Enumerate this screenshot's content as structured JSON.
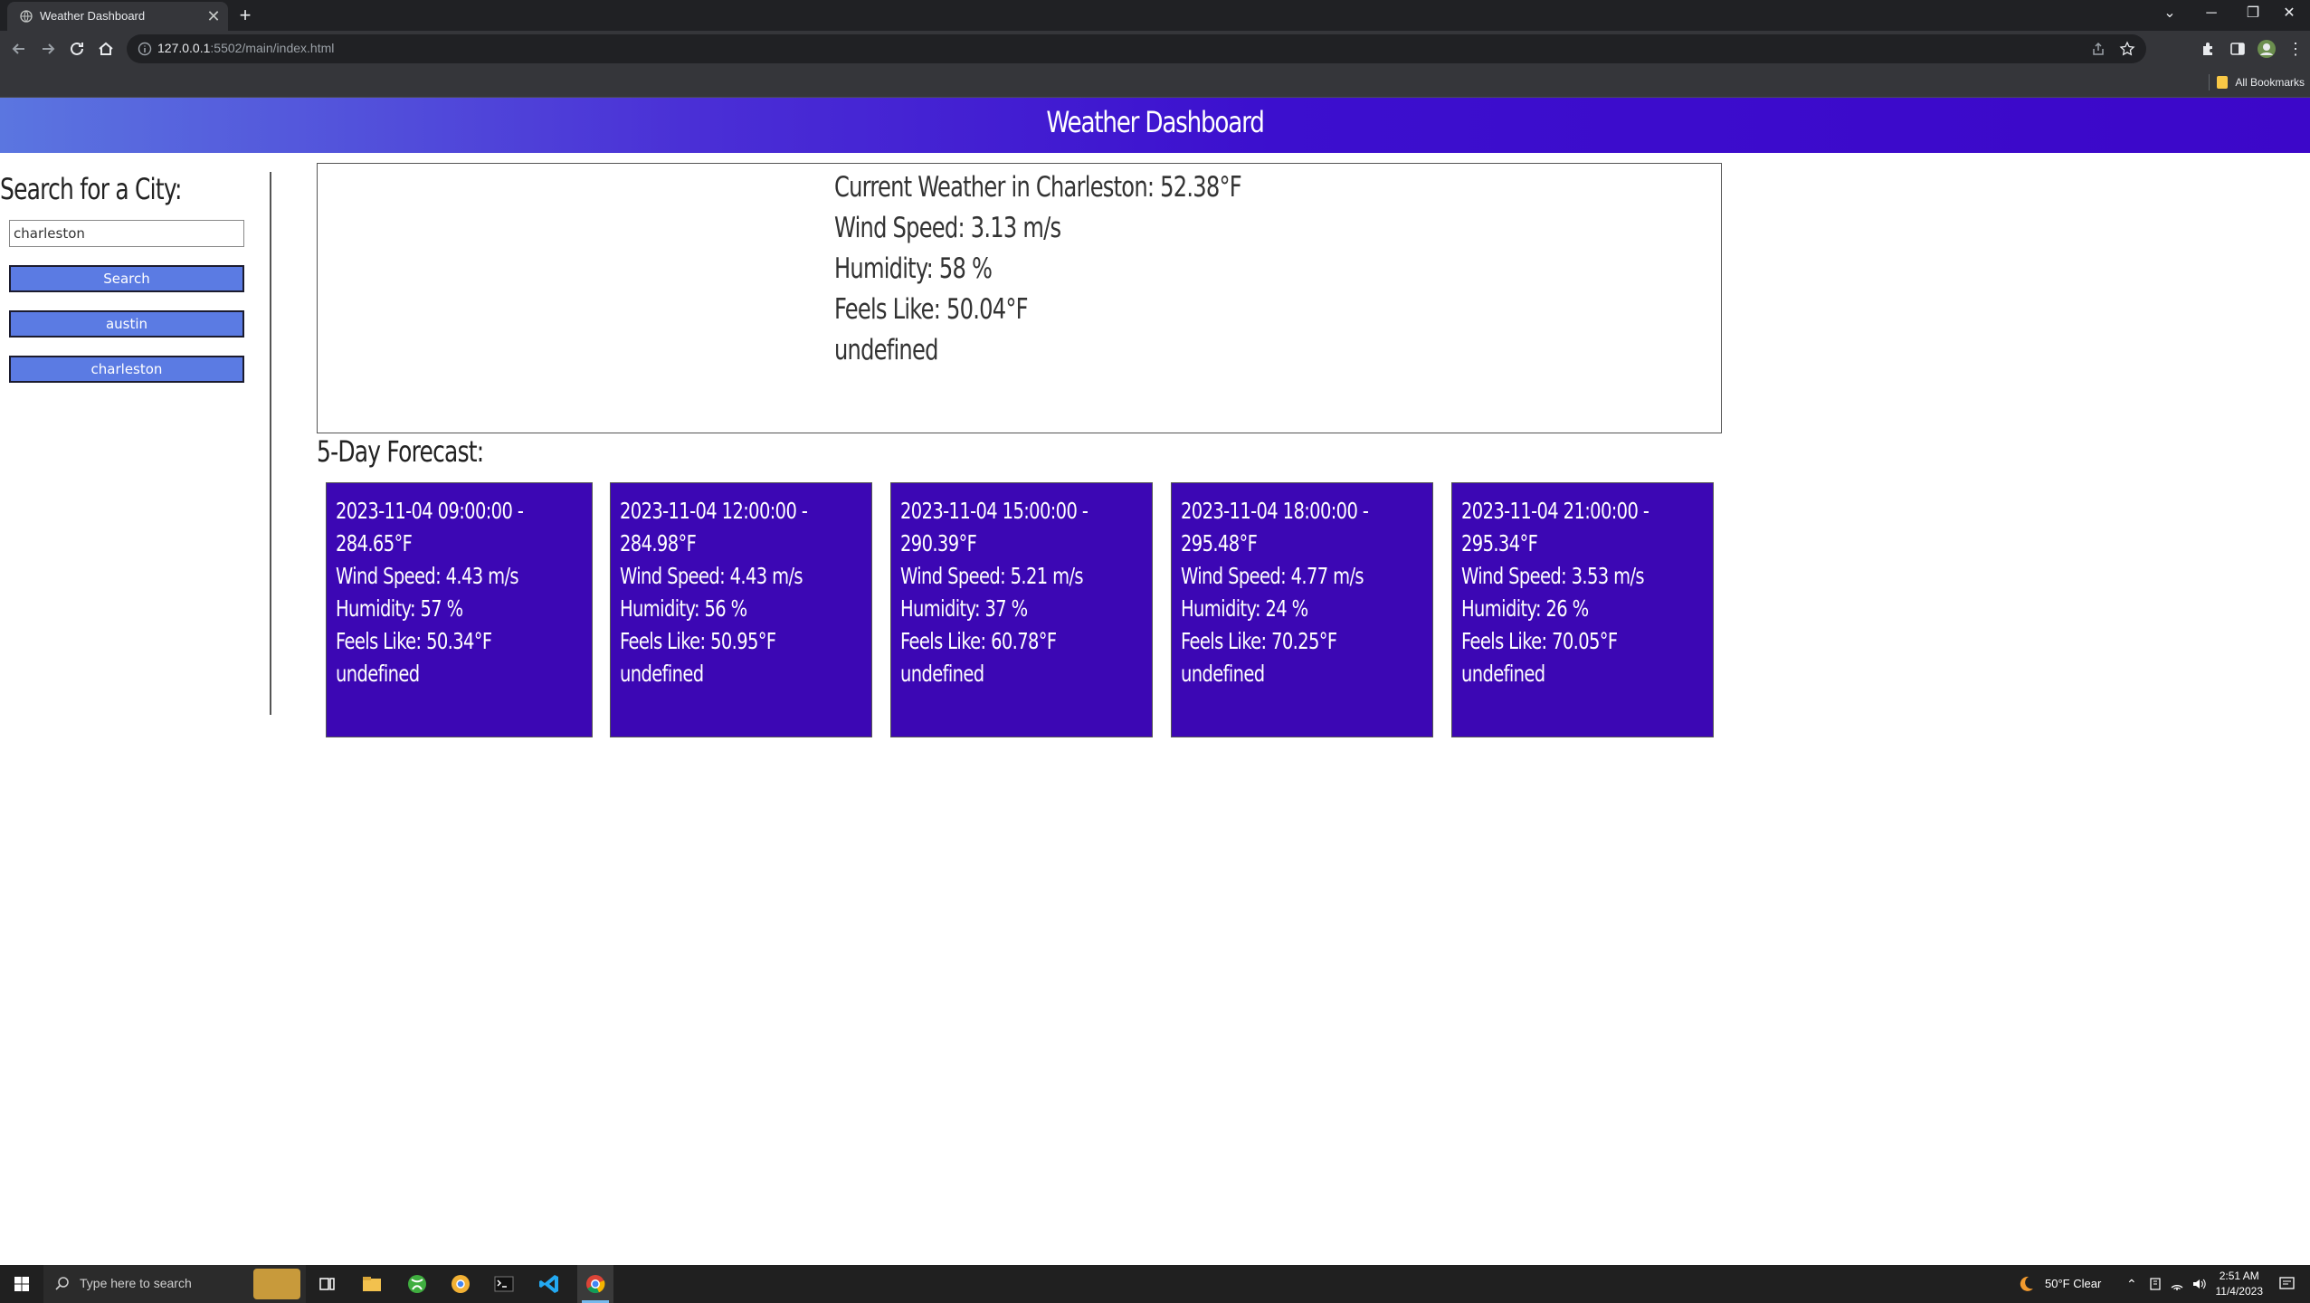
{
  "browser": {
    "tab_title": "Weather Dashboard",
    "tab_close": "✕",
    "new_tab": "+",
    "url_host": "127.0.0.1",
    "url_path": ":5502/main/index.html",
    "all_bookmarks": "All Bookmarks"
  },
  "app": {
    "title": "Weather Dashboard"
  },
  "sidebar": {
    "heading": "Search for a City:",
    "input_value": "charleston",
    "search_label": "Search",
    "history": [
      "austin",
      "charleston"
    ]
  },
  "current": {
    "line1": "Current Weather in Charleston: 52.38°F",
    "line2": "Wind Speed: 3.13 m/s",
    "line3": "Humidity: 58 %",
    "line4": "Feels Like: 50.04°F",
    "line5": "undefined"
  },
  "forecast": {
    "heading": "5-Day Forecast:",
    "cards": [
      {
        "l1": "2023-11-04 09:00:00 -",
        "l2": "284.65°F",
        "l3": "Wind Speed: 4.43 m/s",
        "l4": "Humidity: 57 %",
        "l5": "Feels Like: 50.34°F",
        "l6": "undefined"
      },
      {
        "l1": "2023-11-04 12:00:00 -",
        "l2": "284.98°F",
        "l3": "Wind Speed: 4.43 m/s",
        "l4": "Humidity: 56 %",
        "l5": "Feels Like: 50.95°F",
        "l6": "undefined"
      },
      {
        "l1": "2023-11-04 15:00:00 -",
        "l2": "290.39°F",
        "l3": "Wind Speed: 5.21 m/s",
        "l4": "Humidity: 37 %",
        "l5": "Feels Like: 60.78°F",
        "l6": "undefined"
      },
      {
        "l1": "2023-11-04 18:00:00 -",
        "l2": "295.48°F",
        "l3": "Wind Speed: 4.77 m/s",
        "l4": "Humidity: 24 %",
        "l5": "Feels Like: 70.25°F",
        "l6": "undefined"
      },
      {
        "l1": "2023-11-04 21:00:00 -",
        "l2": "295.34°F",
        "l3": "Wind Speed: 3.53 m/s",
        "l4": "Humidity: 26 %",
        "l5": "Feels Like: 70.05°F",
        "l6": "undefined"
      }
    ]
  },
  "taskbar": {
    "search_placeholder": "Type here to search",
    "weather": "50°F  Clear",
    "time": "2:51 AM",
    "date": "11/4/2023"
  },
  "colors": {
    "header_end": "#3c07c9",
    "card_bg": "#3c07b4",
    "button_bg": "#5b7be3"
  }
}
